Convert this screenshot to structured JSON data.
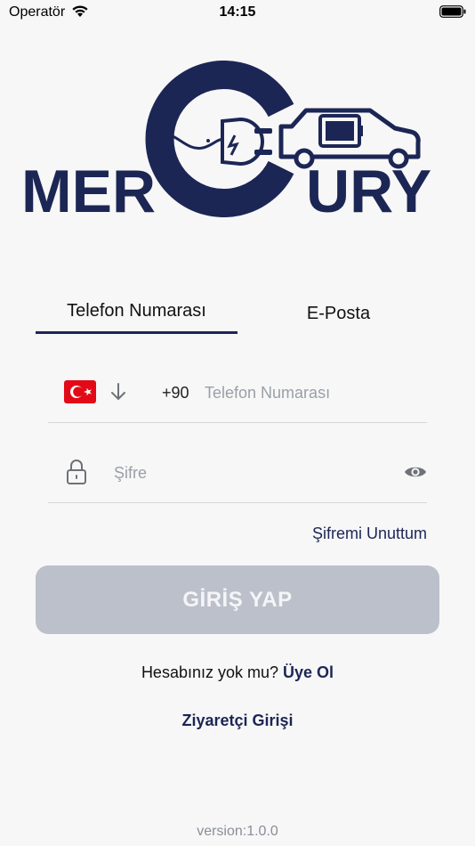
{
  "status_bar": {
    "carrier": "Operatör",
    "time": "14:15"
  },
  "logo": {
    "left_text": "MER",
    "right_text": "URY",
    "brand_color": "#1c2655"
  },
  "tabs": [
    {
      "label": "Telefon Numarası",
      "active": true
    },
    {
      "label": "E-Posta",
      "active": false
    }
  ],
  "phone": {
    "country_code": "+90",
    "value": "",
    "placeholder": "Telefon Numarası"
  },
  "password": {
    "value": "",
    "placeholder": "Şifre"
  },
  "forgot_password": "Şifremi Unuttum",
  "login_button": "GİRİŞ YAP",
  "signup": {
    "prompt": "Hesabınız yok mu?",
    "link": "Üye Ol"
  },
  "guest_login": "Ziyaretçi Girişi",
  "version": "version:1.0.0",
  "colors": {
    "accent": "#1c2655",
    "button_disabled": "#bcc0ca",
    "background": "#f7f7f7"
  },
  "icons": [
    "wifi-icon",
    "battery-icon",
    "turkey-flag-icon",
    "arrow-down-icon",
    "lock-icon",
    "eye-icon"
  ]
}
